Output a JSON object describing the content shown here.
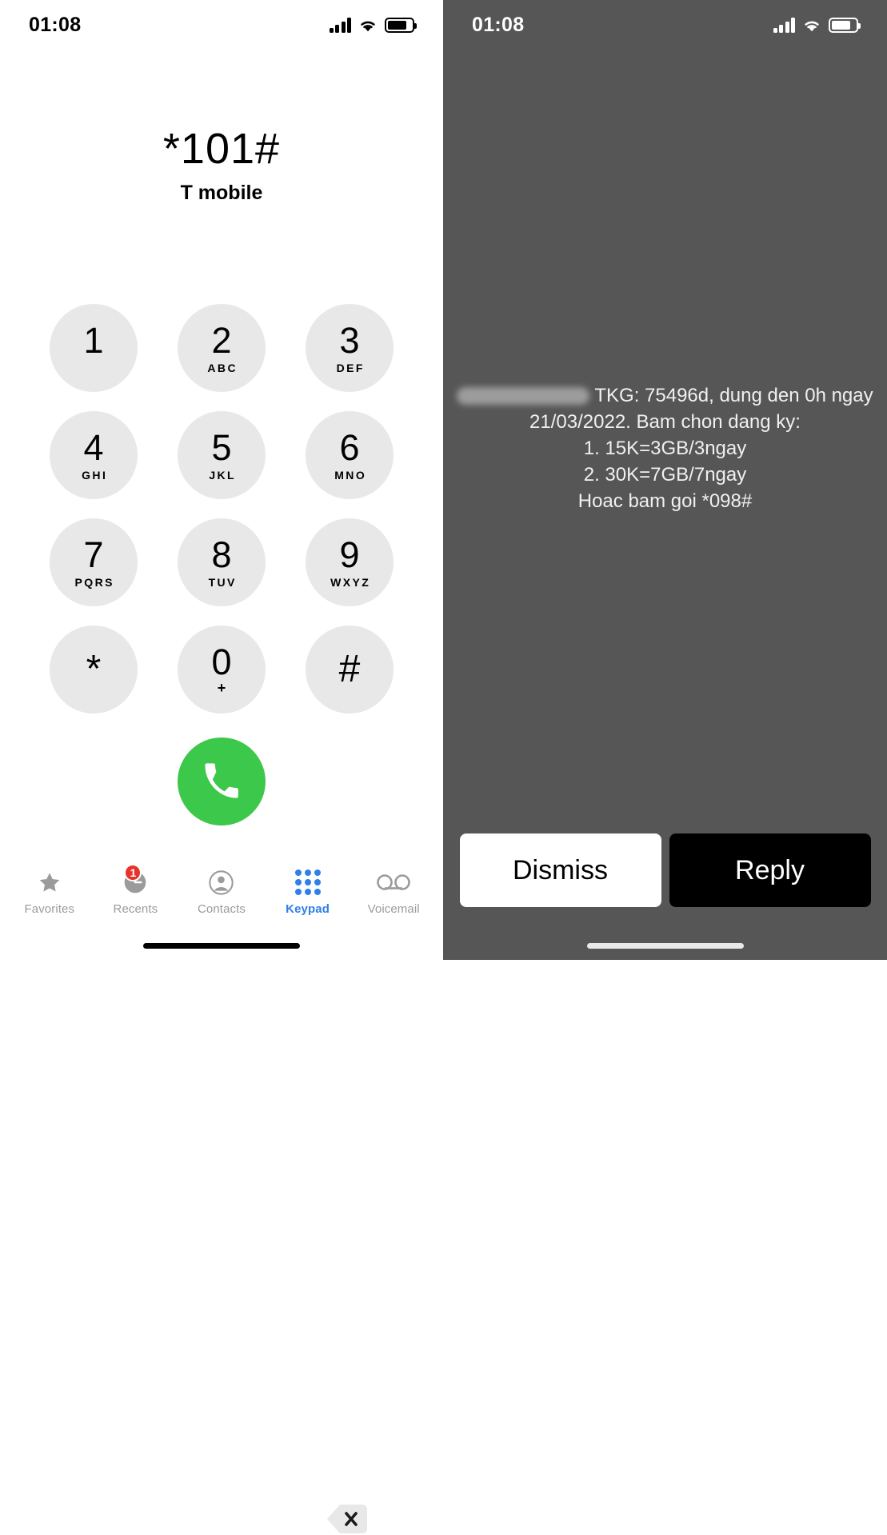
{
  "left_screen": {
    "status_bar": {
      "time": "01:08",
      "icons": [
        "cellular-signal-icon",
        "wifi-icon",
        "battery-icon"
      ]
    },
    "dialed": {
      "number": "*101#",
      "carrier": "T mobile"
    },
    "keypad": {
      "keys": [
        {
          "digit": "1",
          "letters": ""
        },
        {
          "digit": "2",
          "letters": "ABC"
        },
        {
          "digit": "3",
          "letters": "DEF"
        },
        {
          "digit": "4",
          "letters": "GHI"
        },
        {
          "digit": "5",
          "letters": "JKL"
        },
        {
          "digit": "6",
          "letters": "MNO"
        },
        {
          "digit": "7",
          "letters": "PQRS"
        },
        {
          "digit": "8",
          "letters": "TUV"
        },
        {
          "digit": "9",
          "letters": "WXYZ"
        },
        {
          "digit": "*",
          "letters": ""
        },
        {
          "digit": "0",
          "letters": "+"
        },
        {
          "digit": "#",
          "letters": ""
        }
      ],
      "key_bg_color": "#e8e8e8"
    },
    "call_button": {
      "icon": "phone-handset-icon",
      "color": "#3cc84a"
    },
    "delete_button": {
      "icon": "backspace-delete-icon"
    },
    "tab_bar": {
      "items": [
        {
          "label": "Favorites",
          "icon": "star-icon",
          "active": false,
          "badge": ""
        },
        {
          "label": "Recents",
          "icon": "clock-icon",
          "active": false,
          "badge": "1"
        },
        {
          "label": "Contacts",
          "icon": "person-circle-icon",
          "active": false,
          "badge": ""
        },
        {
          "label": "Keypad",
          "icon": "keypad-dots-icon",
          "active": true,
          "badge": ""
        },
        {
          "label": "Voicemail",
          "icon": "voicemail-icon",
          "active": false,
          "badge": ""
        }
      ],
      "active_color": "#2f7fe8",
      "inactive_color": "#9b9b9b",
      "badge_color": "#e8332a"
    }
  },
  "right_screen": {
    "status_bar": {
      "time": "01:08",
      "icons": [
        "cellular-signal-icon",
        "wifi-icon",
        "battery-icon"
      ]
    },
    "background_color": "#565656",
    "notification": {
      "redacted_sender": "",
      "lines": [
        "TKG: 75496d, dung den 0h ngay",
        "21/03/2022. Bam chon dang ky:",
        "1. 15K=3GB/3ngay",
        "2. 30K=7GB/7ngay",
        "Hoac bam goi *098#"
      ]
    },
    "actions": {
      "dismiss_label": "Dismiss",
      "reply_label": "Reply"
    }
  }
}
